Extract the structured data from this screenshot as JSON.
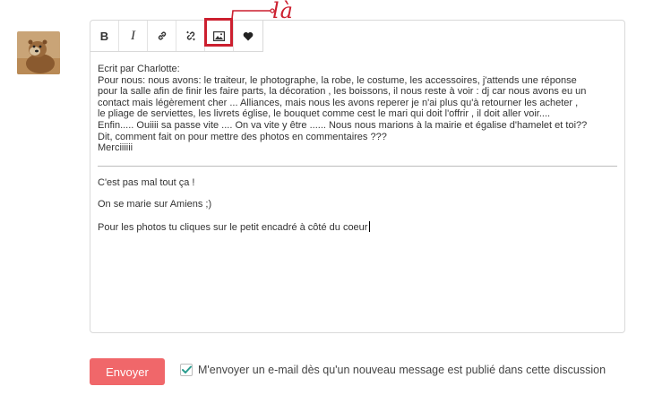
{
  "annotation": {
    "text": "là",
    "color": "#cc1f2f"
  },
  "toolbar": {
    "buttons": [
      {
        "name": "bold",
        "glyph": "B"
      },
      {
        "name": "italic",
        "glyph": "I"
      },
      {
        "name": "link",
        "icon": "link-icon"
      },
      {
        "name": "unlink",
        "icon": "unlink-icon"
      },
      {
        "name": "image",
        "icon": "image-icon"
      },
      {
        "name": "heart",
        "icon": "heart-icon"
      }
    ]
  },
  "quote": {
    "header": "Ecrit par Charlotte:",
    "lines": [
      "Pour nous: nous avons: le traiteur, le photographe, la robe, le costume, les accessoires, j'attends une réponse",
      "pour la salle afin de finir les faire parts, la décoration , les boissons, il nous reste à voir : dj car nous avons eu un",
      "contact mais légèrement cher ... Alliances, mais nous les avons reperer je n'ai plus qu'à retourner les acheter ,",
      "le pliage de serviettes, les livrets église, le bouquet comme cest le mari qui doit l'offrir , il doit aller voir....",
      "Enfin..... Ouiiii sa passe vite .... On va vite y être ...... Nous nous marions à la mairie et égalise d'hamelet et toi??",
      "Dit, comment fait on pour mettre des photos en commentaires ???",
      "Merciiiiii"
    ]
  },
  "reply": {
    "lines": [
      "C'est pas mal tout ça !",
      "On se marie sur Amiens ;)",
      "Pour les photos tu cliques sur le petit encadré à côté du coeur"
    ]
  },
  "send_button": {
    "label": "Envoyer",
    "color": "#f0676a"
  },
  "notify": {
    "checked": true,
    "label": "M'envoyer un e-mail dès qu'un nouveau message est publié dans cette discussion",
    "check_color": "#2a9d8f"
  }
}
